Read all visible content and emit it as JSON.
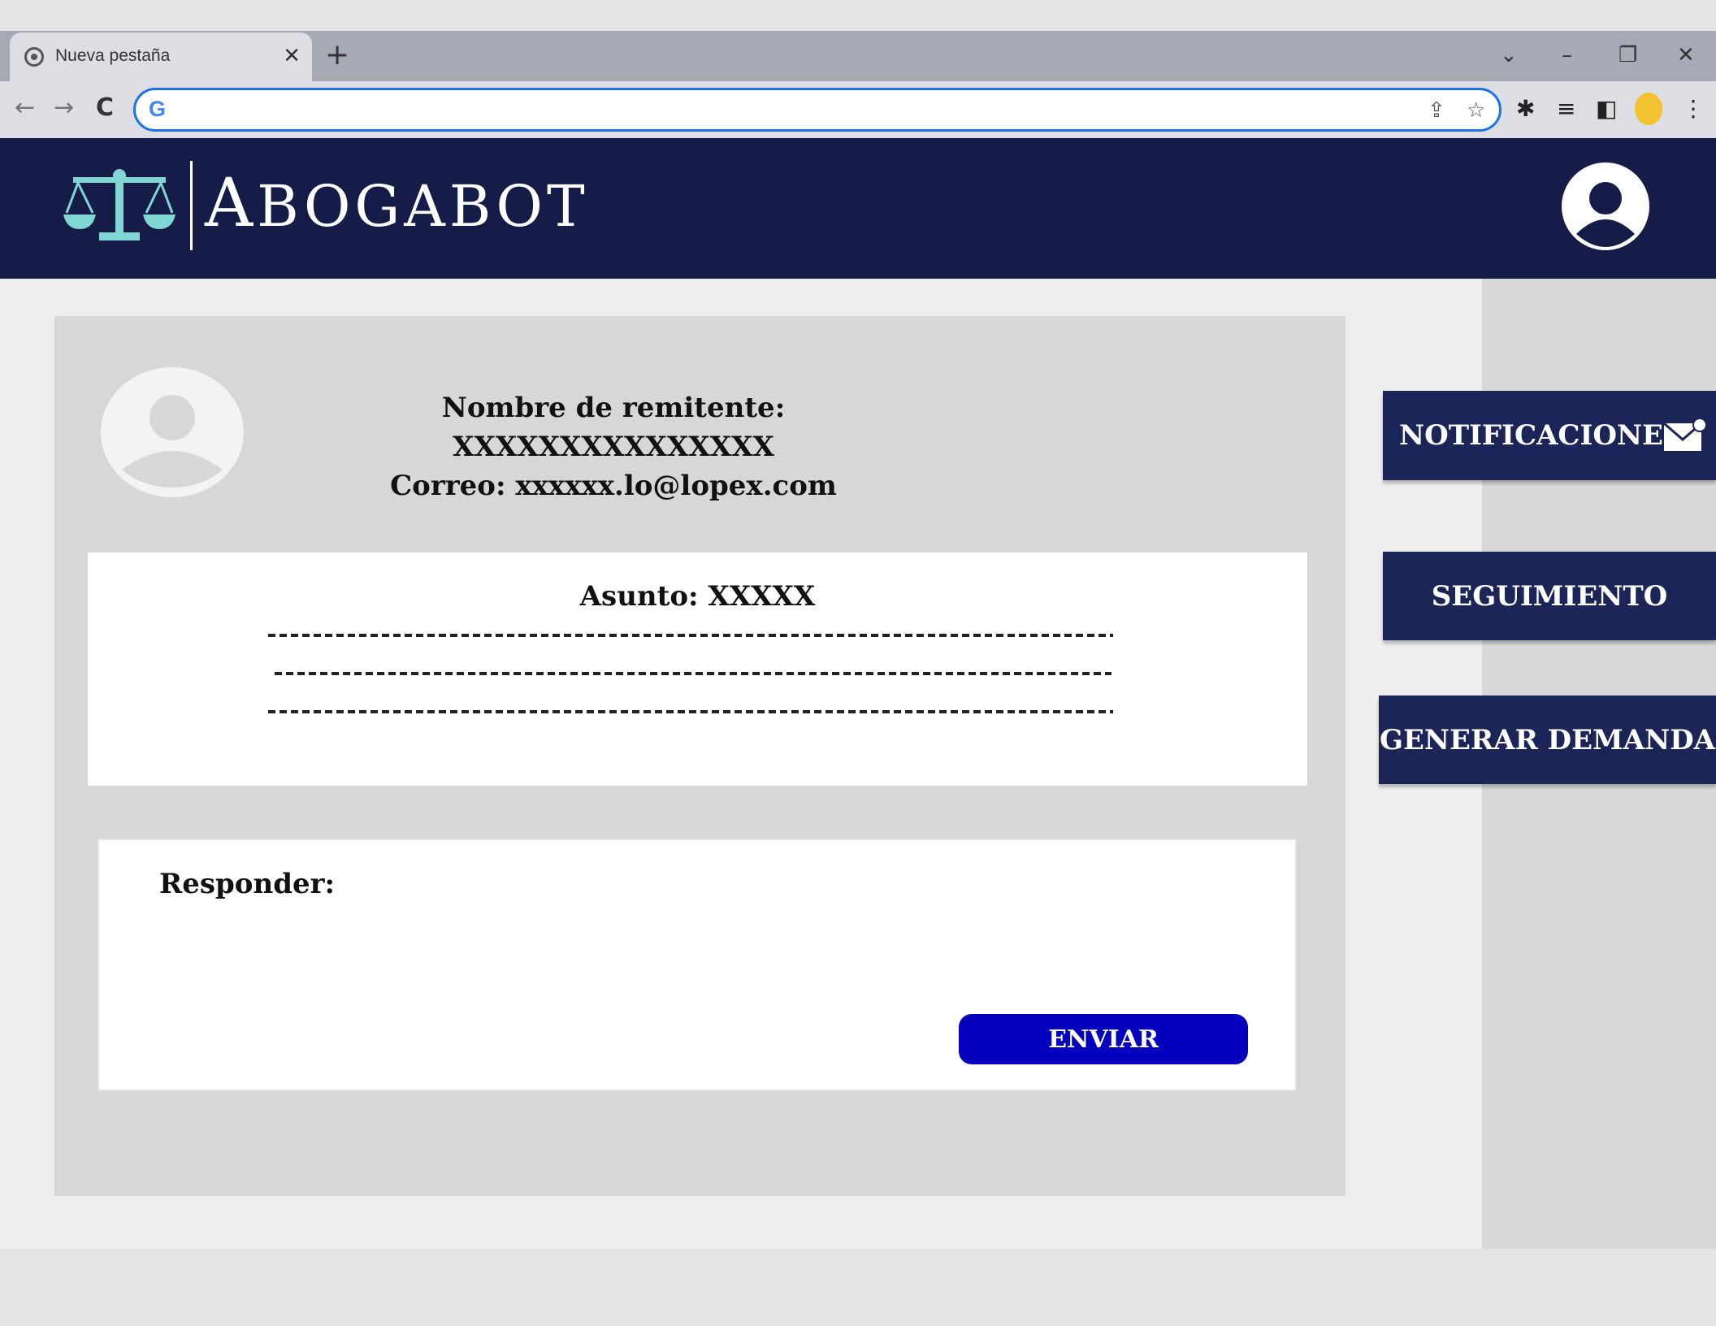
{
  "browser": {
    "tab_title": "Nueva pestaña",
    "tab_close": "✕",
    "new_tab": "+",
    "address_value": "",
    "address_placeholder": "",
    "google_logo": "G",
    "icons": [
      "back-arrow-icon",
      "forward-arrow-icon",
      "reload-icon",
      "share-icon",
      "star-icon",
      "extensions-icon",
      "reading-list-icon",
      "side-panel-icon",
      "profile-icon",
      "menu-icon"
    ],
    "window_controls": {
      "tab_search": "⌄",
      "minimize": "–",
      "restore": "❐",
      "close": "✕"
    },
    "glyphs": {
      "back": "←",
      "forward": "→",
      "reload": "C",
      "share": "⇪",
      "star": "☆",
      "extensions": "✱",
      "reading_list": "≡",
      "side_panel": "◧",
      "menu": "⋮"
    }
  },
  "header": {
    "brand_first": "A",
    "brand_rest": "BOGABOT",
    "logo_icon": "scales-of-justice-icon",
    "user_icon": "user-avatar-icon"
  },
  "message": {
    "sender_line": "Nombre de remitente: XXXXXXXXXXXXXXX",
    "email_line": "Correo: xxxxxx.lo@lopex.com",
    "subject_line": "Asunto: XXXXX",
    "reply_label": "Responder:",
    "reply_value": "",
    "send_label": "ENVIAR"
  },
  "sidebar": {
    "notifications_label": "NOTIFICACIONES",
    "notifications_icon": "mail-notification-icon",
    "tracking_label": "SEGUIMIENTO",
    "lawsuit_label": "GENERAR DEMANDA"
  },
  "colors": {
    "header_bg": "#151c48",
    "side_button_bg": "#1c2558",
    "send_button_bg": "#0500be",
    "logo_accent": "#7fd6d2",
    "card_bg": "#d7d7d7"
  }
}
